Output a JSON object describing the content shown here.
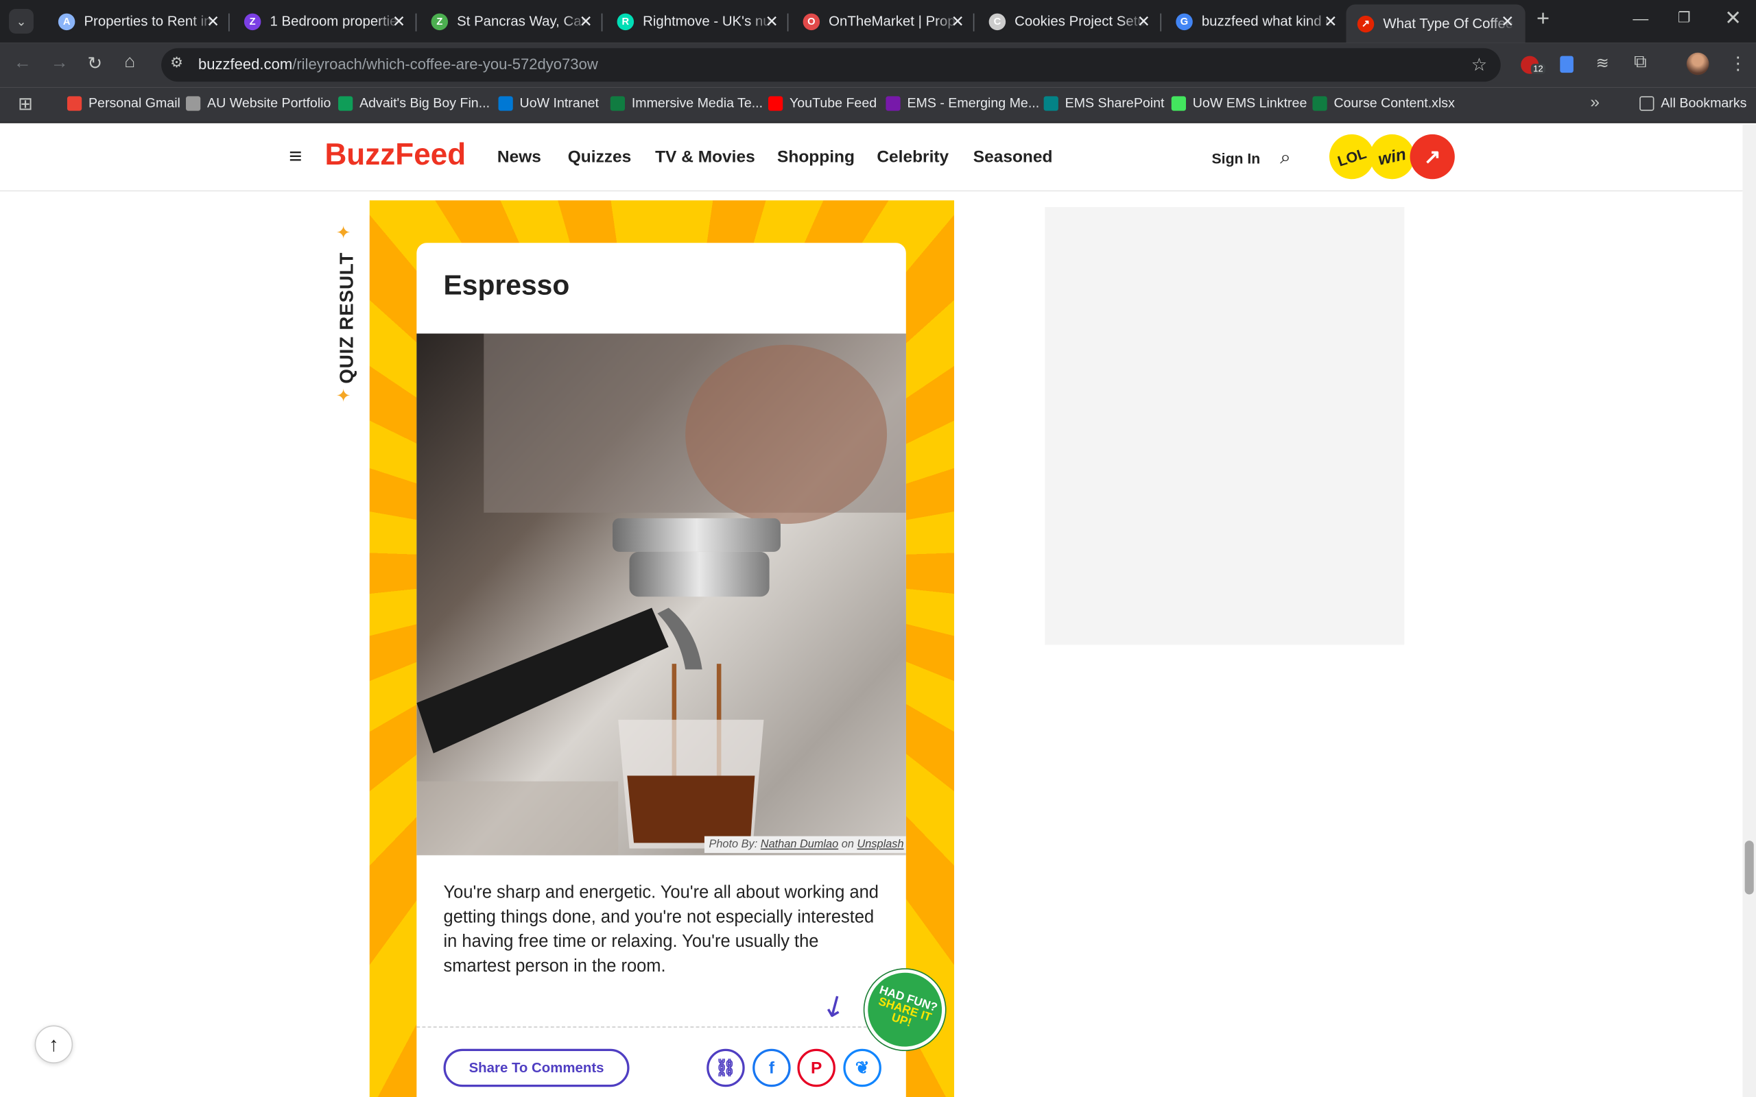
{
  "browser": {
    "tabs": [
      {
        "title": "Properties to Rent in",
        "color": "#8ab4f8",
        "glyph": "A"
      },
      {
        "title": "1 Bedroom propertie",
        "color": "#7b3fe4",
        "glyph": "Z"
      },
      {
        "title": "St Pancras Way, Cam",
        "color": "#4caf50",
        "glyph": "Z"
      },
      {
        "title": "Rightmove - UK's nu",
        "color": "#00deb6",
        "glyph": "R"
      },
      {
        "title": "OnTheMarket | Prop",
        "color": "#e24a4a",
        "glyph": "O"
      },
      {
        "title": "Cookies Project Setu",
        "color": "#cccccc",
        "glyph": "C"
      },
      {
        "title": "buzzfeed what kind o",
        "color": "#4285f4",
        "glyph": "G"
      },
      {
        "title": "What Type Of Coffee",
        "color": "#e32400",
        "glyph": "↗"
      }
    ],
    "url_host": "buzzfeed.com",
    "url_path": "/rileyroach/which-coffee-are-you-572dyo73ow",
    "extension_badge": "12",
    "bookmarks": [
      {
        "label": "Personal Gmail",
        "color": "#ea4335"
      },
      {
        "label": "AU Website Portfolio",
        "color": "#999999"
      },
      {
        "label": "Advait's Big Boy Fin...",
        "color": "#0f9d58"
      },
      {
        "label": "UoW Intranet",
        "color": "#0078d4"
      },
      {
        "label": "Immersive Media Te...",
        "color": "#107c41"
      },
      {
        "label": "YouTube Feed",
        "color": "#ff0000"
      },
      {
        "label": "EMS - Emerging Me...",
        "color": "#7719aa"
      },
      {
        "label": "EMS SharePoint",
        "color": "#038387"
      },
      {
        "label": "UoW EMS Linktree",
        "color": "#43e55e"
      },
      {
        "label": "Course Content.xlsx",
        "color": "#107c41"
      }
    ],
    "all_bookmarks": "All Bookmarks"
  },
  "site": {
    "logo": "BuzzFeed",
    "nav": [
      "News",
      "Quizzes",
      "TV & Movies",
      "Shopping",
      "Celebrity",
      "Seasoned"
    ],
    "sign_in": "Sign In",
    "badges": [
      "LOL",
      "win"
    ]
  },
  "quiz": {
    "label": "QUIZ RESULT",
    "result_title": "Espresso",
    "photo_by": "Photo By:",
    "photographer": "Nathan Dumlao",
    "on": "on",
    "source": "Unsplash",
    "description": "You're sharp and energetic. You're all about working and getting things done, and you're not especially interested in having free time or relaxing. You're usually the smartest person in the room.",
    "share_button": "Share To Comments",
    "hadfun_line1": "HAD FUN?",
    "hadfun_line2": "SHARE IT",
    "hadfun_line3": "UP!"
  }
}
